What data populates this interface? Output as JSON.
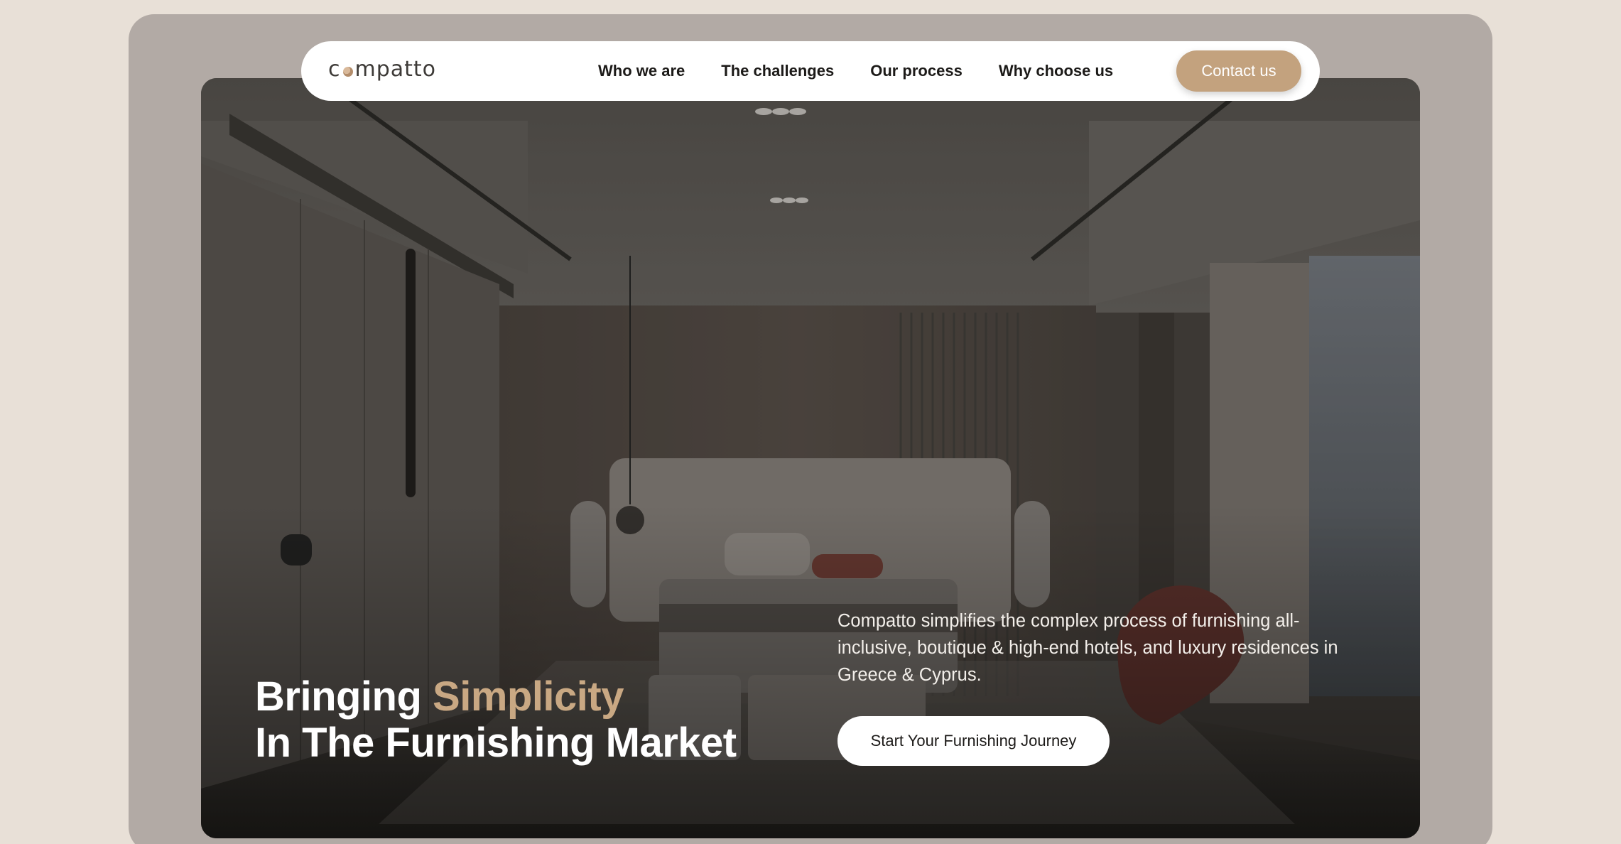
{
  "brand": {
    "logo_first": "c",
    "logo_rest": "mpatto",
    "accent_color": "#c3a27e",
    "headline_accent_color": "#c9a883"
  },
  "nav": {
    "items": [
      {
        "label": "Who we are"
      },
      {
        "label": "The challenges"
      },
      {
        "label": "Our process"
      },
      {
        "label": "Why choose us"
      }
    ],
    "contact_label": "Contact us"
  },
  "hero": {
    "headline_part1": "Bringing ",
    "headline_accent": "Simplicity",
    "headline_line2": "In The Furnishing Market",
    "description": "Compatto simplifies the complex process of furnishing all-inclusive, boutique & high-end hotels, and luxury residences in Greece & Cyprus.",
    "cta_label": "Start Your Furnishing Journey",
    "background_image": "hotel-bedroom-interior"
  }
}
